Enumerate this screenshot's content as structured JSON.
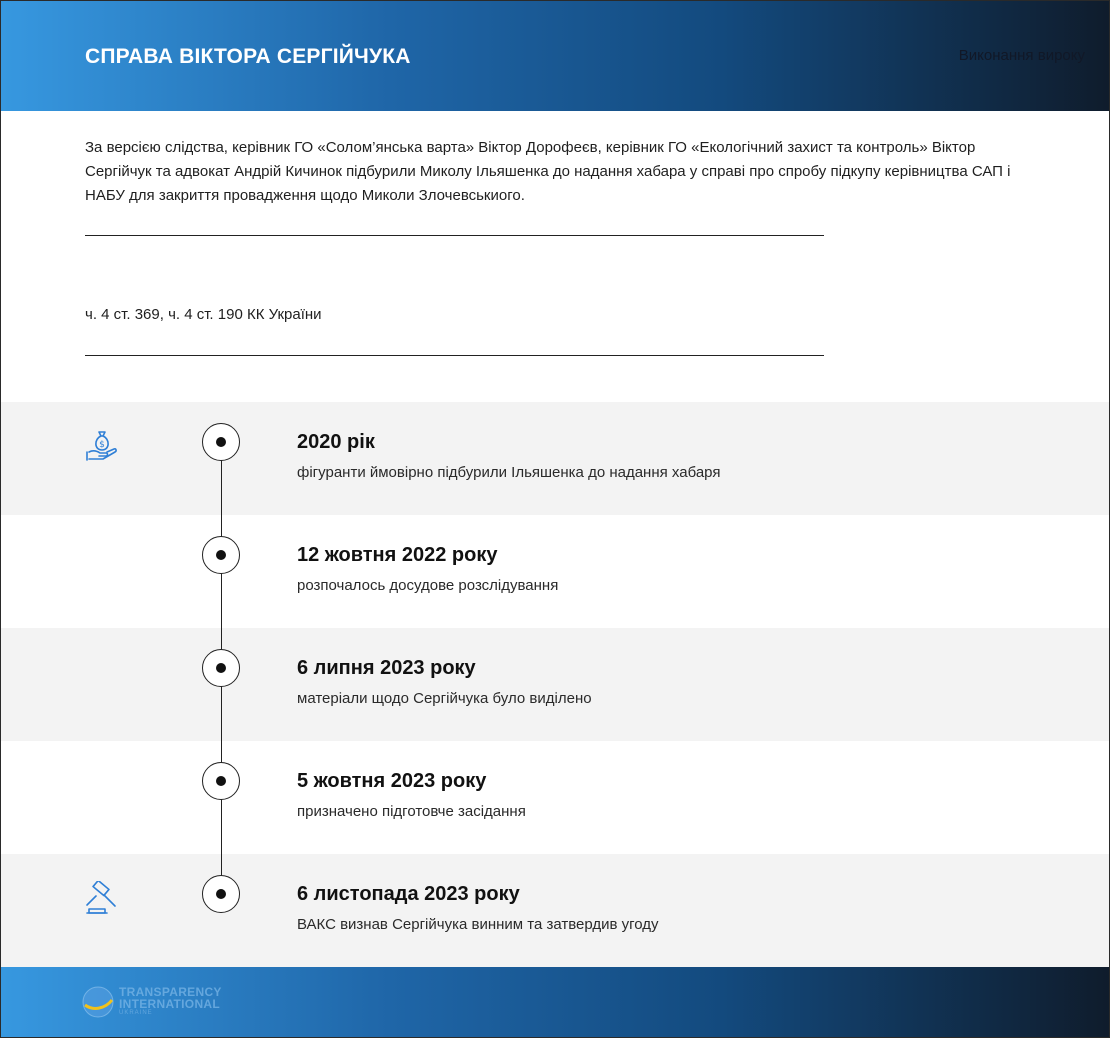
{
  "header": {
    "title": "СПРАВА ВІКТОРА СЕРГІЙЧУКА",
    "status": "Виконання вироку"
  },
  "description": "За версією слідства, керівник ГО «Солом’янська варта» Віктор Дорофеєв, керівник ГО «Екологічний захист та контроль» Віктор Сергійчук та адвокат Андрій Кичинок підбурили Миколу Ільяшенка до надання хабара у справі про спробу підкупу керівництва САП і НАБУ для закриття провадження щодо Миколи Злочевськиого.",
  "articles": "ч. 4 ст. 369, ч. 4 ст. 190 КК України",
  "timeline": [
    {
      "date": "2020 рік",
      "event": "фігуранти ймовірно підбурили Ільяшенка до надання хабаря",
      "icon": "money-bag-hand-icon"
    },
    {
      "date": "12 жовтня 2022 року",
      "event": "розпочалось досудове розслідування",
      "icon": ""
    },
    {
      "date": "6 липня 2023 року",
      "event": "матеріали щодо Сергійчука було виділено",
      "icon": ""
    },
    {
      "date": "5 жовтня 2023 року",
      "event": "призначено підготовче засідання",
      "icon": ""
    },
    {
      "date": "6 листопада 2023 року",
      "event": "ВАКС визнав Сергійчука винним та затвердив угоду",
      "icon": "gavel-icon"
    }
  ],
  "footer": {
    "logo_line1": "TRANSPARENCY",
    "logo_line2": "INTERNATIONAL",
    "logo_line3": "UKRAINE"
  },
  "colors": {
    "gradient_start": "#3798e0",
    "gradient_end": "#0f1c2c",
    "icon_blue": "#2f7fd6",
    "row_shade": "#f3f3f3"
  }
}
